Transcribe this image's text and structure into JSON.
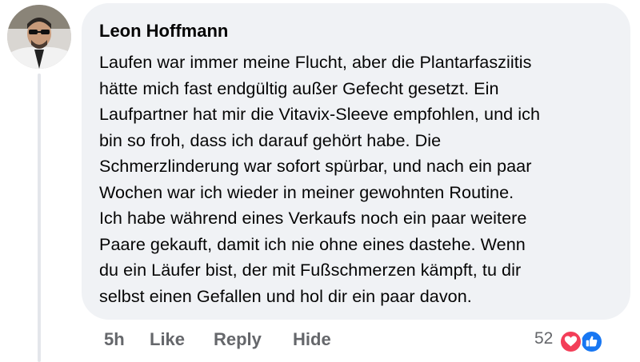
{
  "comment": {
    "author": "Leon Hoffmann",
    "lines": [
      "Laufen war immer meine Flucht, aber die Plantarfasziitis",
      "hätte mich fast endgültig außer Gefecht gesetzt. Ein",
      "Laufpartner hat mir die Vitavix-Sleeve empfohlen, und ich",
      "bin so froh, dass ich darauf gehört habe. Die",
      "Schmerzlinderung war sofort spürbar, und nach ein paar",
      "Wochen war ich wieder in meiner gewohnten Routine.",
      "Ich habe während eines Verkaufs noch ein paar weitere",
      "Paare gekauft, damit ich nie ohne eines dastehe. Wenn",
      "du ein Läufer bist, der mit Fußschmerzen kämpft, tu dir",
      "selbst einen Gefallen und hol dir ein paar davon."
    ]
  },
  "actions": {
    "time": "5h",
    "like": "Like",
    "reply": "Reply",
    "hide": "Hide",
    "reaction_count": "52"
  },
  "reactions": {
    "icons": [
      "heart-icon",
      "thumbs-up-icon"
    ],
    "colors": {
      "love": "#f33e58",
      "like": "#1877f2"
    }
  },
  "colors": {
    "bubble": "#f0f2f5",
    "text": "#050505",
    "secondary": "#65676b"
  }
}
